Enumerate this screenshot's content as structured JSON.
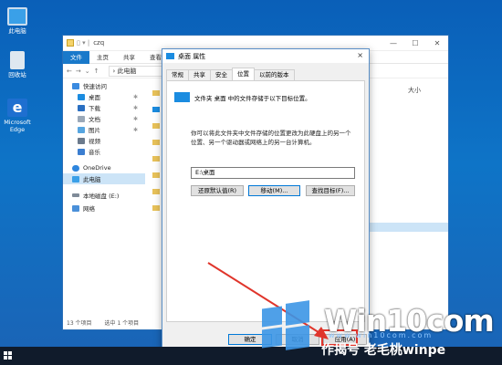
{
  "desktop": {
    "icons": [
      {
        "label": "此电脑",
        "icon": "this-pc-icon"
      },
      {
        "label": "回收站",
        "icon": "recycle-bin-icon"
      },
      {
        "label": "Microsoft Edge",
        "icon": "edge-icon"
      }
    ]
  },
  "explorer": {
    "title": "czq",
    "ribbon_tabs": [
      "文件",
      "主页",
      "共享",
      "查看"
    ],
    "breadcrumb": "此电脑",
    "column_size": "大小",
    "nav_items": [
      {
        "label": "快速访问",
        "level": 0
      },
      {
        "label": "桌面",
        "level": 1
      },
      {
        "label": "下载",
        "level": 1
      },
      {
        "label": "文档",
        "level": 1
      },
      {
        "label": "图片",
        "level": 1
      },
      {
        "label": "视频",
        "level": 1
      },
      {
        "label": "音乐",
        "level": 1
      },
      {
        "label": "OneDrive",
        "level": 0
      },
      {
        "label": "此电脑",
        "level": 0
      },
      {
        "label": "本地磁盘 (E:)",
        "level": 0
      },
      {
        "label": "网络",
        "level": 0
      }
    ],
    "status_count": "13 个项目",
    "status_selected": "选中 1 个项目"
  },
  "dialog": {
    "title": "桌面 属性",
    "close": "×",
    "tabs": [
      "常规",
      "共享",
      "安全",
      "位置",
      "以前的版本"
    ],
    "active_tab": "位置",
    "desc_title": "文件夹 桌面 中的文件存储于以下目标位置。",
    "desc_body": "你可以将此文件夹中文件存储的位置更改为此硬盘上的另一个位置、另一个驱动器或网络上的另一台计算机。",
    "path": "E:\\桌面",
    "btn_restore": "还原默认值(R)",
    "btn_move": "移动(M)...",
    "btn_find": "查找目标(F)...",
    "btn_ok": "确定",
    "btn_cancel": "取消",
    "btn_apply": "应用(A)"
  },
  "watermark": {
    "brand": "Win10com",
    "url": "www.win10com.com",
    "subtitle": "作揭号 老毛桃winpe"
  },
  "colors": {
    "accent": "#0078d7",
    "arrow": "#e0352b"
  }
}
